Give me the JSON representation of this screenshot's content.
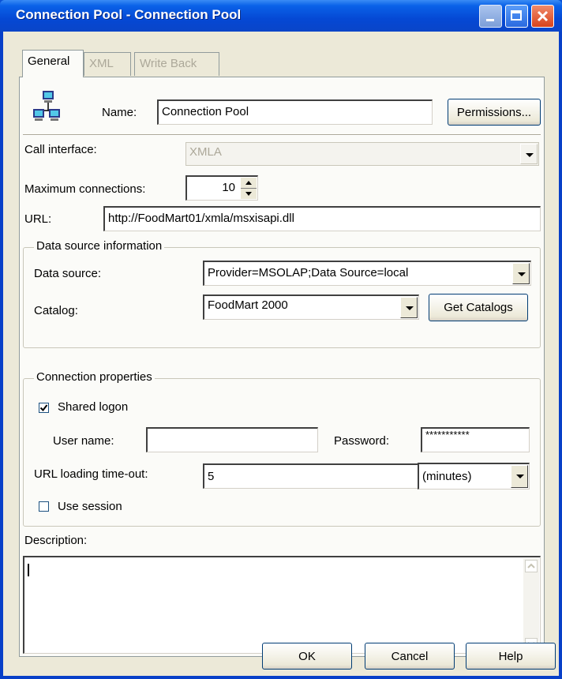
{
  "window": {
    "title": "Connection Pool - Connection Pool"
  },
  "tabs": [
    "General",
    "XML",
    "Write Back"
  ],
  "general": {
    "name_label": "Name:",
    "name_value": "Connection Pool",
    "permissions_button": "Permissions...",
    "call_interface_label": "Call interface:",
    "call_interface_value": "XMLA",
    "max_connections_label": "Maximum connections:",
    "max_connections_value": "10",
    "url_label": "URL:",
    "url_value": "http://FoodMart01/xmla/msxisapi.dll"
  },
  "data_source": {
    "group_label": "Data source information",
    "data_source_label": "Data source:",
    "data_source_value": "Provider=MSOLAP;Data Source=local",
    "catalog_label": "Catalog:",
    "catalog_value": "FoodMart 2000",
    "get_catalogs_button": "Get Catalogs"
  },
  "connection": {
    "group_label": "Connection properties",
    "shared_logon_label": "Shared logon",
    "shared_logon_checked": true,
    "username_label": "User name:",
    "username_value": "",
    "password_label": "Password:",
    "password_value": "***********",
    "timeout_label": "URL loading time-out:",
    "timeout_value": "5",
    "timeout_unit": "(minutes)",
    "use_session_label": "Use session",
    "use_session_checked": false
  },
  "description": {
    "label": "Description:",
    "value": ""
  },
  "footer": {
    "ok": "OK",
    "cancel": "Cancel",
    "help": "Help"
  },
  "icons": [
    "network-computers-icon",
    "minimize-icon",
    "maximize-icon",
    "close-icon",
    "scroll-up-icon",
    "scroll-down-icon",
    "spin-up-icon",
    "spin-down-icon"
  ]
}
